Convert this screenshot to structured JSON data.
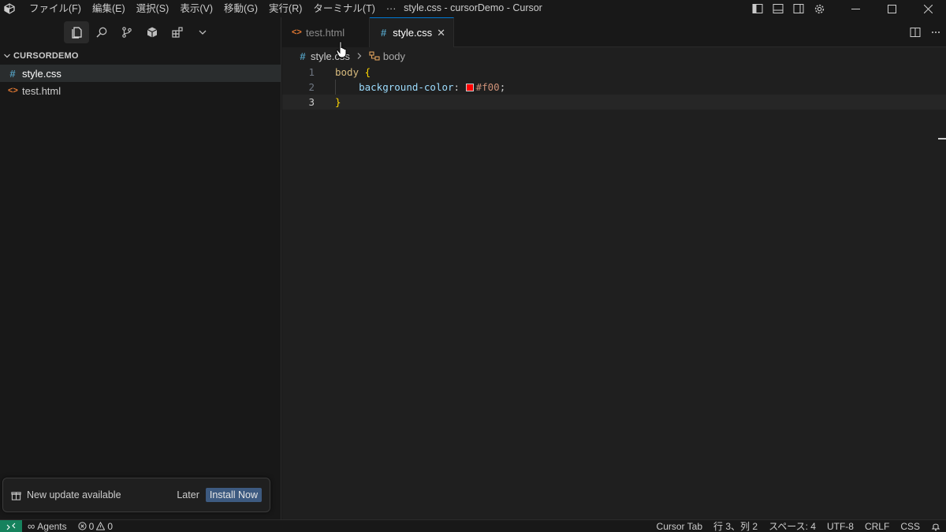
{
  "titlebar": {
    "menus": [
      "ファイル(F)",
      "編集(E)",
      "選択(S)",
      "表示(V)",
      "移動(G)",
      "実行(R)",
      "ターミナル(T)",
      "···"
    ],
    "window_title": "style.css - cursorDemo - Cursor"
  },
  "sidebar": {
    "section_title": "CURSORDEMO",
    "files": [
      {
        "icon": "#",
        "name": "style.css",
        "type": "css",
        "selected": true
      },
      {
        "icon": "<>",
        "name": "test.html",
        "type": "html",
        "selected": false
      }
    ]
  },
  "notification": {
    "message": "New update available",
    "later_label": "Later",
    "install_label": "Install Now"
  },
  "tabs": [
    {
      "icon": "<>",
      "label": "test.html",
      "active": false
    },
    {
      "icon": "#",
      "label": "style.css",
      "active": true,
      "close": "✕"
    }
  ],
  "breadcrumb": {
    "file_icon": "#",
    "file": "style.css",
    "symbol": "body"
  },
  "code": {
    "lines": [
      {
        "no": "1",
        "selector": "body",
        "brace": "{"
      },
      {
        "no": "2",
        "property": "background-color",
        "colon": ":",
        "swatch_color": "#ff0000",
        "value": "#f00",
        "semicolon": ";"
      },
      {
        "no": "3",
        "brace": "}"
      }
    ],
    "current_line": 3
  },
  "statusbar": {
    "agents": "Agents",
    "errors": "0",
    "warnings": "0",
    "cursor_tab": "Cursor Tab",
    "position": "行 3、列 2",
    "spaces": "スペース: 4",
    "encoding": "UTF-8",
    "eol": "CRLF",
    "language": "CSS"
  },
  "colors": {
    "accent": "#0078d4",
    "remote": "#16825d",
    "install_button": "#3d5a80",
    "css_icon": "#519aba",
    "html_icon": "#e37933"
  }
}
